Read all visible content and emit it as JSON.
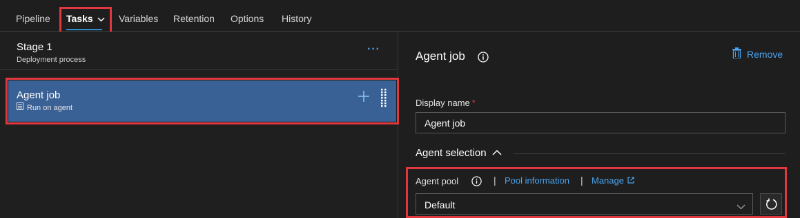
{
  "nav": {
    "tabs": [
      {
        "label": "Pipeline"
      },
      {
        "label": "Tasks",
        "active": true
      },
      {
        "label": "Variables"
      },
      {
        "label": "Retention"
      },
      {
        "label": "Options"
      },
      {
        "label": "History"
      }
    ]
  },
  "stage": {
    "title": "Stage 1",
    "subtitle": "Deployment process",
    "more_label": "···"
  },
  "agent_card": {
    "title": "Agent job",
    "subtitle": "Run on agent"
  },
  "details": {
    "title": "Agent job",
    "remove_label": "Remove",
    "display_name_label": "Display name",
    "required_mark": "*",
    "display_name_value": "Agent job",
    "agent_selection_label": "Agent selection",
    "agent_pool_label": "Agent pool",
    "separator": "|",
    "pool_information_link": "Pool information",
    "manage_link": "Manage",
    "agent_pool_value": "Default"
  },
  "colors": {
    "accent": "#4aa3f0",
    "selected_card": "#3a6195",
    "highlight_box": "#e0383e",
    "background": "#1e1e1e"
  },
  "icons": [
    "chevron-down-icon",
    "more-icon",
    "agent-icon",
    "plus-icon",
    "drag-handle-icon",
    "info-icon",
    "trash-icon",
    "chevron-up-icon",
    "external-link-icon",
    "refresh-icon"
  ]
}
